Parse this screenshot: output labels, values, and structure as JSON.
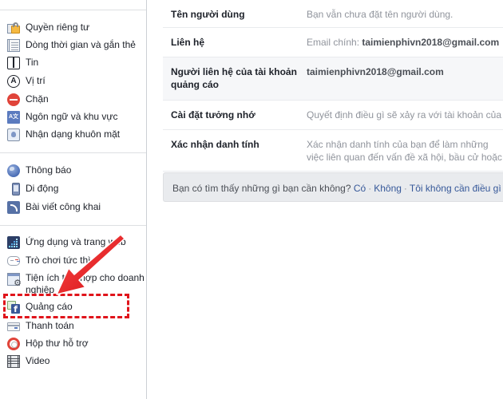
{
  "sidebar": {
    "groups": [
      {
        "items": [
          {
            "label": "Quyền riêng tư",
            "icon": "lock-icon"
          },
          {
            "label": "Dòng thời gian và gắn thẻ",
            "icon": "timeline-icon"
          },
          {
            "label": "Tin",
            "icon": "book-icon"
          },
          {
            "label": "Vị trí",
            "icon": "location-icon"
          },
          {
            "label": "Chặn",
            "icon": "block-icon"
          },
          {
            "label": "Ngôn ngữ và khu vực",
            "icon": "language-icon"
          },
          {
            "label": "Nhận dạng khuôn mặt",
            "icon": "face-recognition-icon"
          }
        ]
      },
      {
        "items": [
          {
            "label": "Thông báo",
            "icon": "globe-icon"
          },
          {
            "label": "Di động",
            "icon": "mobile-icon"
          },
          {
            "label": "Bài viết công khai",
            "icon": "rss-icon"
          }
        ]
      },
      {
        "items": [
          {
            "label": "Ứng dụng và trang web",
            "icon": "apps-icon"
          },
          {
            "label": "Trò chơi tức thì",
            "icon": "gamepad-icon"
          },
          {
            "label": "Tiện ích tích hợp cho doanh nghiệp",
            "icon": "business-integration-icon"
          },
          {
            "label": "Quảng cáo",
            "icon": "ads-icon",
            "highlighted": true
          },
          {
            "label": "Thanh toán",
            "icon": "payment-card-icon"
          },
          {
            "label": "Hộp thư hỗ trợ",
            "icon": "support-lifebuoy-icon"
          },
          {
            "label": "Video",
            "icon": "film-icon"
          }
        ]
      }
    ]
  },
  "settings": {
    "rows": [
      {
        "label": "Tên người dùng",
        "value": "Bạn vẫn chưa đặt tên người dùng."
      },
      {
        "label": "Liên hệ",
        "value_prefix": "Email chính: ",
        "value": "taimienphivn2018@gmail.com"
      },
      {
        "label": "Người liên hệ của tài khoản quảng cáo",
        "value": "taimienphivn2018@gmail.com"
      },
      {
        "label": "Cài đặt tưởng nhớ",
        "value": "Quyết định điều gì sẽ xảy ra với tài khoản của bạn"
      },
      {
        "label": "Xác nhận danh tính",
        "value": "Xác nhận danh tính của bạn để làm những việc liên quan đến vấn đề xã hội, bầu cử hoặc chính trị."
      }
    ]
  },
  "feedback": {
    "question": "Bạn có tìm thấy những gì bạn cần không?",
    "yes": "Có",
    "no": "Không",
    "dont_need": "Tôi không cần điều gì",
    "separator": "·"
  },
  "annotation": {
    "color": "#e0141b",
    "target": "Quảng cáo"
  }
}
